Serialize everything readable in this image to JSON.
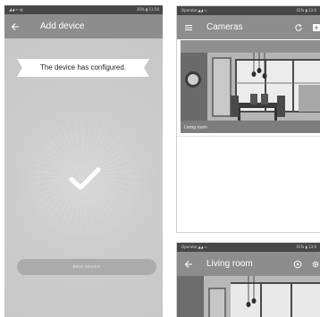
{
  "add_device_screen": {
    "status_left": "◢◢ ≈ ▤",
    "status_right": "35% ▮ 11:56",
    "title": "Add device",
    "message": "The device has configured.",
    "bind_button": "BIND DEVICE",
    "icons": {
      "back": "back-arrow-icon",
      "check": "checkmark-icon"
    }
  },
  "cameras_screen": {
    "status_left": "Operator◢◢ ≈",
    "status_right": "41% ▮ 13:0",
    "title": "Cameras",
    "camera_label": "Living room",
    "icons": {
      "menu": "menu-icon",
      "refresh": "refresh-icon",
      "add": "add-icon"
    }
  },
  "live_screen": {
    "status_left": "Operator◢◢ ≈",
    "status_right": "41% ▮ 13:0",
    "title": "Living room",
    "icons": {
      "back": "back-arrow-icon",
      "playback": "playback-icon",
      "settings": "settings-icon"
    }
  },
  "colors": {
    "status_bar": "#474747",
    "app_bar": "#8d8d8d",
    "background_grey": "#c9c9c9",
    "button": "#ababab"
  }
}
